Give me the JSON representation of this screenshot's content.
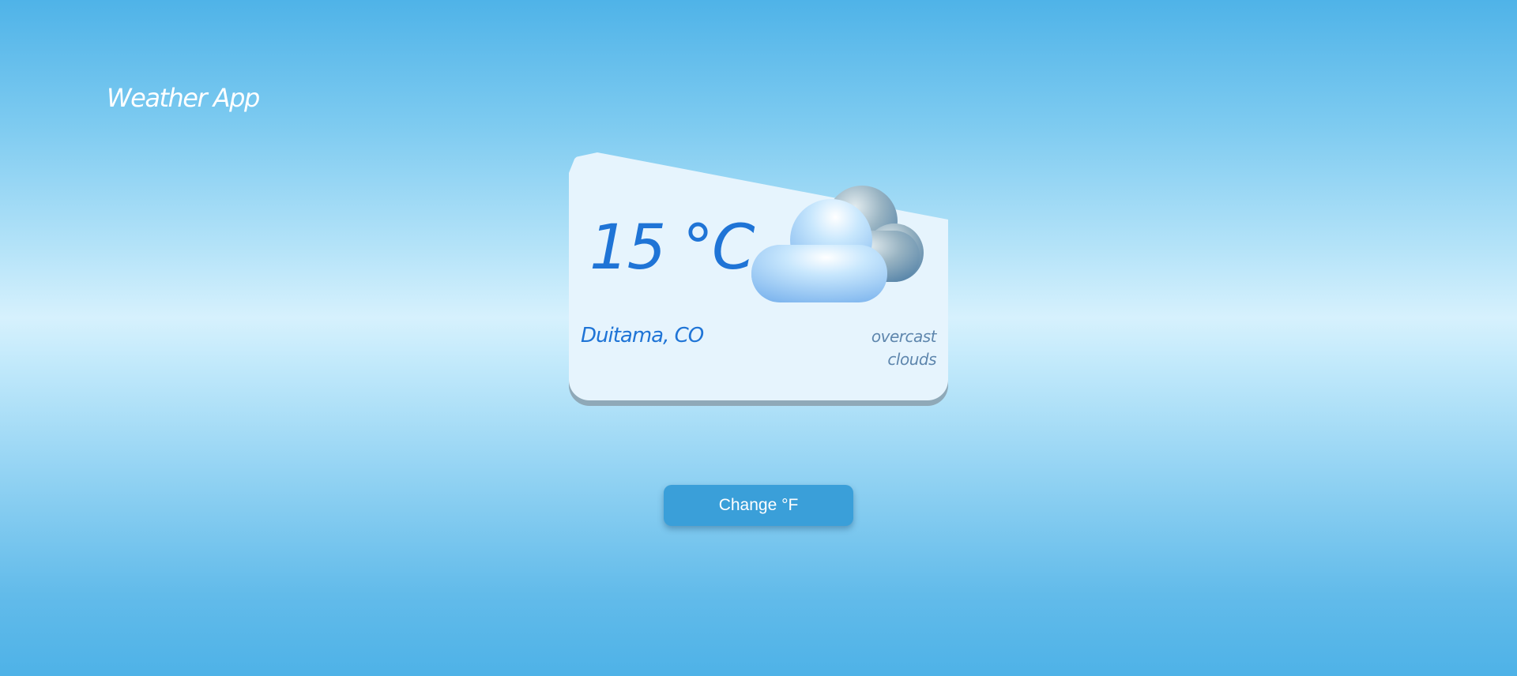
{
  "app": {
    "title": "Weather App"
  },
  "weather": {
    "temperature": "15 °C",
    "location": "Duitama, CO",
    "description": "overcast clouds",
    "icon": "overcast-clouds-icon"
  },
  "controls": {
    "change_unit_label": "Change °F"
  },
  "colors": {
    "accent_text": "#1f74d6",
    "secondary_text": "#5e86ad",
    "button_bg": "#3a9fd9",
    "card_bg": "#e6f4fd"
  }
}
